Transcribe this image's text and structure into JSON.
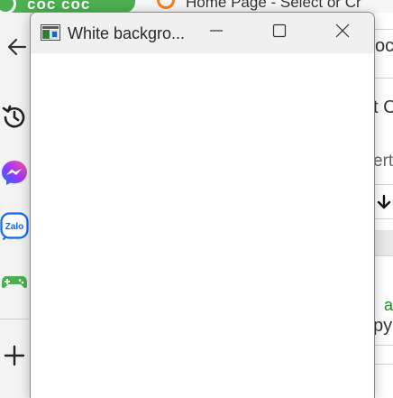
{
  "background_browser": {
    "tabs": [
      {
        "label": "coc coc"
      },
      {
        "label": "Home Page - Select or Cr"
      }
    ],
    "sidebar": {
      "icons": [
        "back-arrow-icon",
        "history-icon",
        "messenger-icon",
        "zalo-icon",
        "gamepad-icon",
        "add-icon"
      ],
      "zalo_label": "Zalo"
    },
    "right_strip": {
      "texts": [
        "oc",
        "t C",
        "ert",
        "a",
        "py"
      ]
    }
  },
  "window": {
    "title": "White backgro...",
    "controls": {
      "minimize": "minimize-icon",
      "maximize": "maximize-icon",
      "close": "close-icon"
    }
  }
}
